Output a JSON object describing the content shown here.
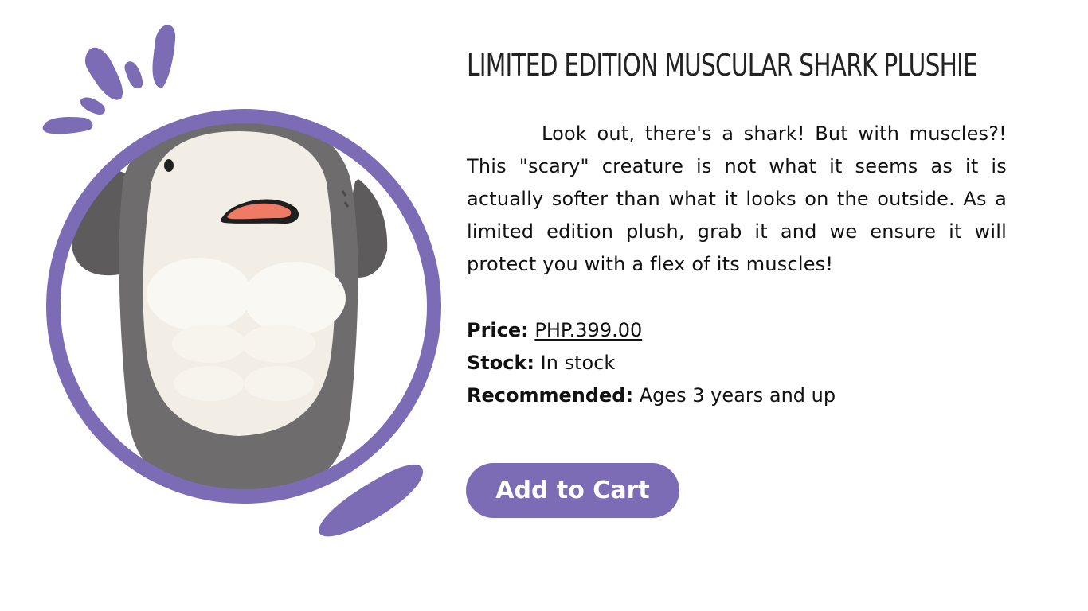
{
  "product": {
    "title": "LIMITED EDITION MUSCULAR SHARK PLUSHIE",
    "description": "Look out, there's a shark! But with muscles?! This \"scary\" creature is not what it seems as it is actually softer than what it looks on the outside. As a limited edition plush, grab it and we ensure it will protect you with a flex of its muscles!",
    "price_label": "Price:",
    "price_value": "PHP.399.00 ",
    "stock_label": "Stock:",
    "stock_value": "In stock",
    "recommended_label": "Recommended:",
    "recommended_value": "Ages 3 years and up",
    "add_to_cart_label": "Add to Cart",
    "image": "muscular-shark-plushie-photo"
  },
  "colors": {
    "accent": "#7c6cb5",
    "text": "#111111",
    "background": "#ffffff"
  }
}
